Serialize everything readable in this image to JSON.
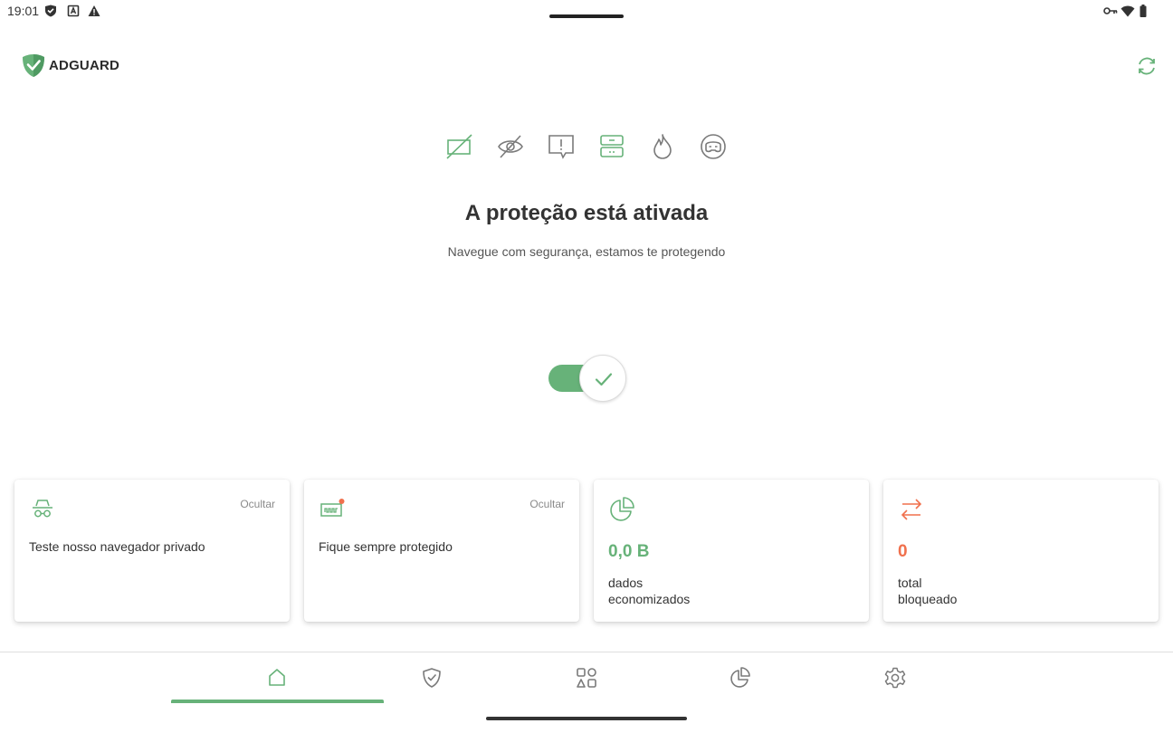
{
  "status_bar": {
    "time": "19:01",
    "left_icons": [
      "shield-icon",
      "a-box-icon",
      "warning-icon"
    ],
    "right_icons": [
      "key-icon",
      "wifi-icon",
      "battery-icon"
    ]
  },
  "header": {
    "brand": "ADGUARD",
    "refresh_icon": "refresh-icon"
  },
  "features": [
    "ad-block-icon",
    "tracking-icon",
    "annoyance-icon",
    "dns-icon",
    "firewall-icon",
    "browsing-security-icon"
  ],
  "protection": {
    "title": "A proteção está ativada",
    "subtitle": "Navegue com segurança, estamos te protegendo",
    "enabled": true
  },
  "cards": [
    {
      "icon": "spy-icon",
      "hide_label": "Ocultar",
      "text": "Teste nosso navegador privado"
    },
    {
      "icon": "license-icon",
      "hide_label": "Ocultar",
      "text": "Fique sempre protegido"
    },
    {
      "icon": "pie-chart-icon",
      "value": "0,0 B",
      "label_line1": "dados",
      "label_line2": "economizados",
      "value_color": "#67b279"
    },
    {
      "icon": "transfer-icon",
      "value": "0",
      "label_line1": "total",
      "label_line2": "bloqueado",
      "value_color": "#f0704d"
    }
  ],
  "nav": {
    "items": [
      "home-icon",
      "protection-icon",
      "apps-icon",
      "statistics-icon",
      "settings-icon"
    ],
    "active": 0
  },
  "colors": {
    "accent": "#67b279",
    "orange": "#f0704d",
    "gray_icon": "#7a7a7a"
  }
}
